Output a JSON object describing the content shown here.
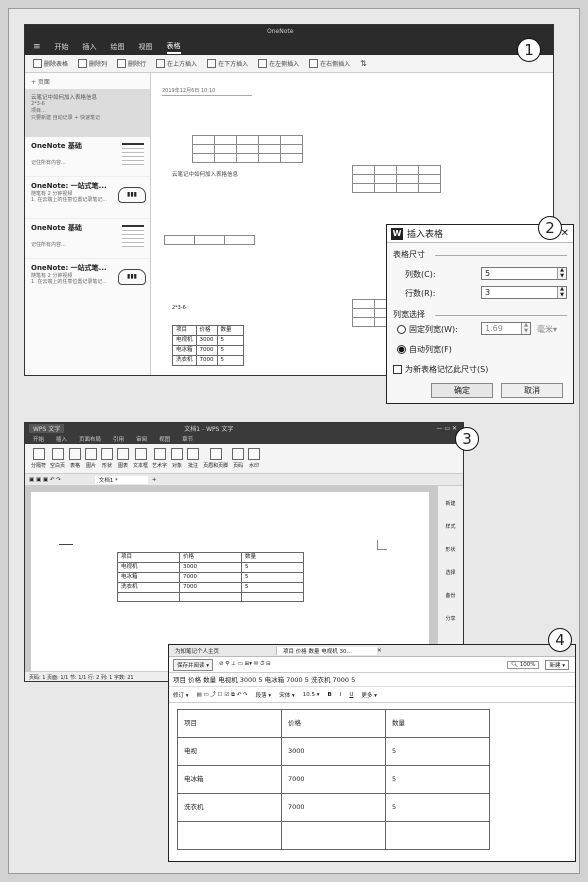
{
  "colors": {
    "onenote_bar": "#2b2b2b",
    "wps_bar": "#3a3a3a",
    "dialog_title": "#f5f5f5",
    "selected": "#e0e0e0"
  },
  "circles": [
    "1",
    "2",
    "3",
    "4"
  ],
  "onenote": {
    "title": "OneNote",
    "menu": [
      "开始",
      "插入",
      "绘图",
      "视图",
      "表格"
    ],
    "toolbar": [
      "删除表格",
      "删除列",
      "删除行",
      "在上方插入",
      "在下方插入",
      "在左侧插入",
      "在右侧插入"
    ],
    "add_page": "+ 页面",
    "pages": [
      {
        "title": "云笔记中如何加入表格信息",
        "sub": "2*3-6\n项目...\n只要新建 自动记录 + 快速笔记"
      },
      {
        "title": "OneNote 基础",
        "sub": "记住所有内容..."
      },
      {
        "title": "OneNote: 一站式笔...",
        "sub": "随笔有 2 分钟视频\n1. 在云端上的任意位置记录笔记..."
      },
      {
        "title": "OneNote 基础",
        "sub": "记住所有内容..."
      },
      {
        "title": "OneNote: 一站式笔...",
        "sub": "随笔有 2 分钟视频\n1. 在云端上的任意位置记录笔记..."
      }
    ],
    "date": "2019年12月6日    10:10",
    "caption": "云笔记中如何加入表格信息",
    "formula": "2*3-6",
    "table": {
      "header": [
        "项目",
        "价格",
        "数量"
      ],
      "rows": [
        [
          "电视机",
          "3000",
          "5"
        ],
        [
          "电冰箱",
          "7000",
          "5"
        ],
        [
          "洗衣机",
          "7000",
          "5"
        ]
      ]
    }
  },
  "dialog": {
    "title": "插入表格",
    "size_label": "表格尺寸",
    "cols_label": "列数(C):",
    "cols_value": "5",
    "rows_label": "行数(R):",
    "rows_value": "3",
    "width_label": "列宽选择",
    "fixed_label": "固定列宽(W):",
    "fixed_value": "1.69",
    "unit": "毫米",
    "auto_label": "自动列宽(F)",
    "remember_label": "为新表格记忆此尺寸(S)",
    "ok": "确定",
    "cancel": "取消"
  },
  "wps": {
    "title": "WPS 文字",
    "doc_title": "文档1 - WPS 文字",
    "tabs": [
      "开始",
      "插入",
      "页面布局",
      "引用",
      "审阅",
      "视图",
      "章节"
    ],
    "ribbon": [
      "分隔符",
      "空白页",
      "表格",
      "图片",
      "形状",
      "图表",
      "文本框",
      "艺术字",
      "对象",
      "批注",
      "页眉和页脚",
      "页码",
      "水印"
    ],
    "doc_tab": "文档1 *",
    "side": [
      "新建",
      "样式",
      "形状",
      "选择",
      "备份",
      "分享"
    ],
    "status": "页码: 1  页面: 1/1  节: 1/1  行: 2  列: 1  字数: 21",
    "table": {
      "header": [
        "项目",
        "价格",
        "数量"
      ],
      "rows": [
        [
          "电视机",
          "3000",
          "5"
        ],
        [
          "电冰箱",
          "7000",
          "5"
        ],
        [
          "洗衣机",
          "7000",
          "5"
        ]
      ]
    }
  },
  "notes": {
    "tabs": [
      "为知笔记个人主页",
      "项目 价格 数量 电视机 30..."
    ],
    "save_btn": "保存并阅读",
    "zoom": "100%",
    "new_btn": "新建",
    "summary": "项目 价格 数量 电视机 3000 5 电冰箱 7000 5 洗衣机 7000 5",
    "edit": "修订",
    "para": "段落",
    "font": "宋体",
    "font_size": "10.5",
    "more": "更多",
    "table": {
      "header": [
        "项目",
        "价格",
        "数量"
      ],
      "rows": [
        [
          "电视",
          "3000",
          "5"
        ],
        [
          "电冰箱",
          "7000",
          "5"
        ],
        [
          "洗衣机",
          "7000",
          "5"
        ],
        [
          "",
          "",
          ""
        ]
      ]
    }
  }
}
